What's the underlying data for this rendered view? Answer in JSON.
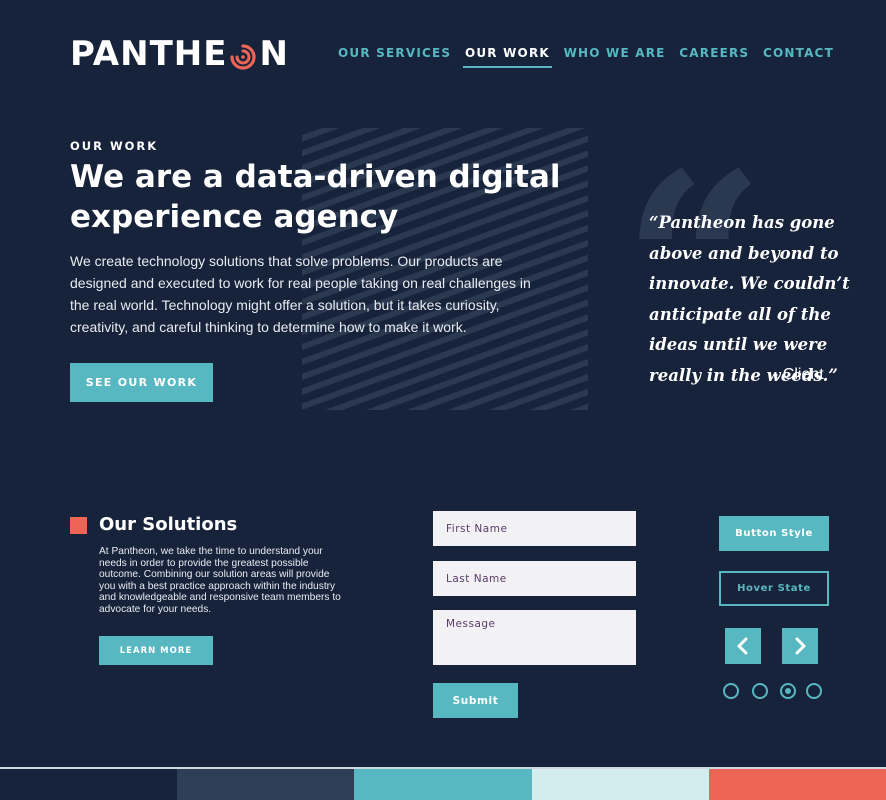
{
  "brand": {
    "logo_before": "PANTHE",
    "logo_after": "N",
    "logo_icon": "swirl-o-icon"
  },
  "nav": {
    "items": [
      {
        "label": "OUR SERVICES",
        "active": false
      },
      {
        "label": "OUR WORK",
        "active": true
      },
      {
        "label": "WHO WE ARE",
        "active": false
      },
      {
        "label": "CAREERS",
        "active": false
      },
      {
        "label": "CONTACT",
        "active": false
      }
    ]
  },
  "hero": {
    "eyebrow": "OUR WORK",
    "title": "We are a data-driven digital experience agency",
    "body": "We create technology solutions that solve problems.  Our products are designed and executed to work for real people taking on real challenges in the real world.  Technology might offer a solution, but it takes curiosity, creativity, and careful thinking to determine how to make it work.",
    "cta_label": "SEE OUR WORK"
  },
  "quote": {
    "mark": "“",
    "text": "“Pantheon has gone above and beyond to innovate. We couldn’t anticipate all of the ideas until we were really in the weeds.”",
    "author": "- Client"
  },
  "solutions": {
    "title": "Our Solutions",
    "body": "At Pantheon, we take the time to understand your needs in order to provide the greatest possible outcome. Combining our solution areas will provide you with a best practice approach within the industry and knowledgeable and responsive team members to advocate for your needs.",
    "cta_label": "LEARN MORE"
  },
  "form": {
    "first_name_placeholder": "First Name",
    "last_name_placeholder": "Last Name",
    "message_placeholder": "Message",
    "submit_label": "Submit"
  },
  "styleguide": {
    "button_style_label": "Button Style",
    "hover_state_label": "Hover State",
    "prev_icon": "chevron-left-icon",
    "next_icon": "chevron-right-icon",
    "dots": [
      false,
      false,
      true,
      false
    ]
  },
  "colors": {
    "background": "#17233a",
    "accent": "#58b8c2",
    "coral": "#ee6455",
    "palette": [
      "#17233a",
      "#2e3e55",
      "#58b8c2",
      "#d3ecee",
      "#ee6455"
    ]
  }
}
